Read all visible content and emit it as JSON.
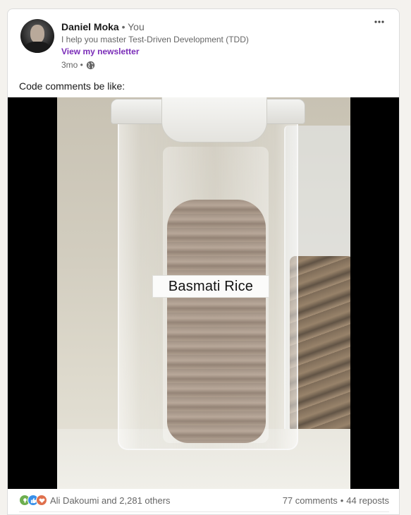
{
  "post": {
    "author": {
      "name": "Daniel Moka",
      "relation": "• You",
      "headline": "I help you master Test-Driven Development (TDD)",
      "newsletter_link": "View my newsletter",
      "age": "3mo •"
    },
    "menu_icon": "more-horizontal-icon",
    "text": "Code comments be like:",
    "image": {
      "label_text": "Basmati Rice"
    },
    "social": {
      "reaction_icons": [
        "insightful-icon",
        "like-icon",
        "love-icon"
      ],
      "reactions_text": "Ali Dakoumi and 2,281 others",
      "comments_text": "77 comments",
      "separator": "•",
      "reposts_text": "44 reposts"
    }
  },
  "colors": {
    "accent": "#7a2cb8",
    "like": "#378fe9",
    "love": "#df704d",
    "insightful": "#6dae4f"
  }
}
